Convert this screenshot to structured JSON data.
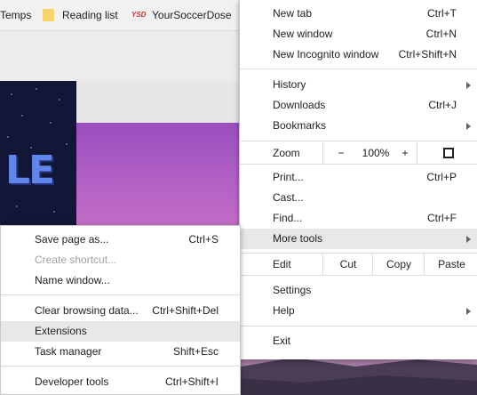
{
  "bookmarks": {
    "items": [
      {
        "label": "Temps"
      },
      {
        "label": "Reading list"
      },
      {
        "label": "YourSoccerDose",
        "icon_text": "YSD"
      }
    ]
  },
  "menu": {
    "new_tab": {
      "label": "New tab",
      "shortcut": "Ctrl+T"
    },
    "new_window": {
      "label": "New window",
      "shortcut": "Ctrl+N"
    },
    "new_incognito": {
      "label": "New Incognito window",
      "shortcut": "Ctrl+Shift+N"
    },
    "history": {
      "label": "History"
    },
    "downloads": {
      "label": "Downloads",
      "shortcut": "Ctrl+J"
    },
    "bookmarks": {
      "label": "Bookmarks"
    },
    "zoom": {
      "label": "Zoom",
      "minus": "−",
      "value": "100%",
      "plus": "+"
    },
    "print": {
      "label": "Print...",
      "shortcut": "Ctrl+P"
    },
    "cast": {
      "label": "Cast..."
    },
    "find": {
      "label": "Find...",
      "shortcut": "Ctrl+F"
    },
    "more_tools": {
      "label": "More tools"
    },
    "edit": {
      "label": "Edit",
      "cut": "Cut",
      "copy": "Copy",
      "paste": "Paste"
    },
    "settings": {
      "label": "Settings"
    },
    "help": {
      "label": "Help"
    },
    "exit": {
      "label": "Exit"
    }
  },
  "submenu": {
    "save_page": {
      "label": "Save page as...",
      "shortcut": "Ctrl+S"
    },
    "create_shortcut": {
      "label": "Create shortcut..."
    },
    "name_window": {
      "label": "Name window..."
    },
    "clear_browsing": {
      "label": "Clear browsing data...",
      "shortcut": "Ctrl+Shift+Del"
    },
    "extensions": {
      "label": "Extensions"
    },
    "task_manager": {
      "label": "Task manager",
      "shortcut": "Shift+Esc"
    },
    "developer_tools": {
      "label": "Developer tools",
      "shortcut": "Ctrl+Shift+I"
    }
  },
  "page": {
    "game_letters": "LE"
  },
  "colors": {
    "menu_bg": "#ffffff",
    "highlight": "#e8e8e8",
    "separator": "#dadce0",
    "disabled_text": "#9aa0a6"
  }
}
